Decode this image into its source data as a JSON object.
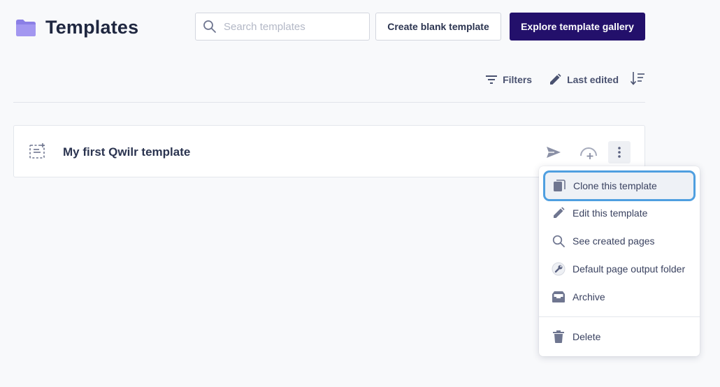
{
  "header": {
    "title": "Templates",
    "search_placeholder": "Search templates",
    "search_value": "",
    "create_blank_label": "Create blank template",
    "explore_gallery_label": "Explore template gallery"
  },
  "toolbar": {
    "filters_label": "Filters",
    "sort_label": "Last edited"
  },
  "templates": [
    {
      "name": "My first Qwilr template"
    }
  ],
  "context_menu": {
    "items": [
      {
        "label": "Clone this template",
        "icon": "clone-icon"
      },
      {
        "label": "Edit this template",
        "icon": "pencil-icon"
      },
      {
        "label": "See created pages",
        "icon": "search-icon"
      },
      {
        "label": "Default page output folder",
        "icon": "wrench-icon"
      },
      {
        "label": "Archive",
        "icon": "archive-icon"
      },
      {
        "label": "Delete",
        "icon": "trash-icon"
      }
    ]
  },
  "colors": {
    "primary": "#23106b",
    "folder": "#8b7fe6",
    "focus_ring": "#4f9fe0",
    "background": "#f8f9fb"
  }
}
